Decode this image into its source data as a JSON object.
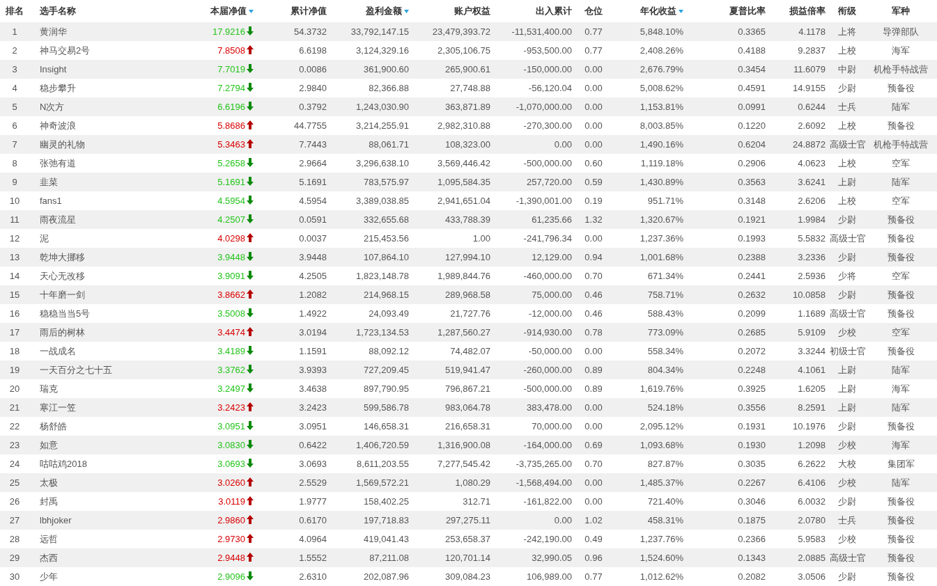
{
  "columns": [
    {
      "label": "排名",
      "sort_indicator": false
    },
    {
      "label": "选手名称",
      "sort_indicator": false
    },
    {
      "label": "本届净值",
      "sort_indicator": true
    },
    {
      "label": "累计净值",
      "sort_indicator": false
    },
    {
      "label": "盈利金额",
      "sort_indicator": true
    },
    {
      "label": "账户权益",
      "sort_indicator": false
    },
    {
      "label": "出入累计",
      "sort_indicator": false
    },
    {
      "label": "仓位",
      "sort_indicator": false
    },
    {
      "label": "年化收益",
      "sort_indicator": true
    },
    {
      "label": "夏普比率",
      "sort_indicator": false
    },
    {
      "label": "损益倍率",
      "sort_indicator": false
    },
    {
      "label": "衔级",
      "sort_indicator": false
    },
    {
      "label": "军种",
      "sort_indicator": false
    }
  ],
  "rows": [
    {
      "rank": "1",
      "name": "黄润华",
      "net_value": "17.9216",
      "rising": false,
      "cells": [
        "54.3732",
        "33,792,147.15",
        "23,479,393.72",
        "-11,531,400.00",
        "0.77",
        "5,848.10%",
        "0.3365",
        "4.1178",
        "上将",
        "导弹部队"
      ]
    },
    {
      "rank": "2",
      "name": "神马交易2号",
      "net_value": "7.8508",
      "rising": true,
      "cells": [
        "6.6198",
        "3,124,329.16",
        "2,305,106.75",
        "-953,500.00",
        "0.77",
        "2,408.26%",
        "0.4188",
        "9.2837",
        "上校",
        "海军"
      ]
    },
    {
      "rank": "3",
      "name": "Insight",
      "net_value": "7.7019",
      "rising": false,
      "cells": [
        "0.0086",
        "361,900.60",
        "265,900.61",
        "-150,000.00",
        "0.00",
        "2,676.79%",
        "0.3454",
        "11.6079",
        "中尉",
        "机枪手特战营"
      ]
    },
    {
      "rank": "4",
      "name": "稳步攀升",
      "net_value": "7.2794",
      "rising": false,
      "cells": [
        "2.9840",
        "82,366.88",
        "27,748.88",
        "-56,120.04",
        "0.00",
        "5,008.62%",
        "0.4591",
        "14.9155",
        "少尉",
        "预备役"
      ]
    },
    {
      "rank": "5",
      "name": "N次方",
      "net_value": "6.6196",
      "rising": false,
      "cells": [
        "0.3792",
        "1,243,030.90",
        "363,871.89",
        "-1,070,000.00",
        "0.00",
        "1,153.81%",
        "0.0991",
        "0.6244",
        "士兵",
        "陆军"
      ]
    },
    {
      "rank": "6",
      "name": "神奇波浪",
      "net_value": "5.8686",
      "rising": true,
      "cells": [
        "44.7755",
        "3,214,255.91",
        "2,982,310.88",
        "-270,300.00",
        "0.00",
        "8,003.85%",
        "0.1220",
        "2.6092",
        "上校",
        "预备役"
      ]
    },
    {
      "rank": "7",
      "name": "幽灵的礼物",
      "net_value": "5.3463",
      "rising": true,
      "cells": [
        "7.7443",
        "88,061.71",
        "108,323.00",
        "0.00",
        "0.00",
        "1,490.16%",
        "0.6204",
        "24.8872",
        "高级士官",
        "机枪手特战营"
      ]
    },
    {
      "rank": "8",
      "name": "张弛有道",
      "net_value": "5.2658",
      "rising": false,
      "cells": [
        "2.9664",
        "3,296,638.10",
        "3,569,446.42",
        "-500,000.00",
        "0.60",
        "1,119.18%",
        "0.2906",
        "4.0623",
        "上校",
        "空军"
      ]
    },
    {
      "rank": "9",
      "name": "韭菜",
      "net_value": "5.1691",
      "rising": false,
      "cells": [
        "5.1691",
        "783,575.97",
        "1,095,584.35",
        "257,720.00",
        "0.59",
        "1,430.89%",
        "0.3563",
        "3.6241",
        "上尉",
        "陆军"
      ]
    },
    {
      "rank": "10",
      "name": "fans1",
      "net_value": "4.5954",
      "rising": false,
      "cells": [
        "4.5954",
        "3,389,038.85",
        "2,941,651.04",
        "-1,390,001.00",
        "0.19",
        "951.71%",
        "0.3148",
        "2.6206",
        "上校",
        "空军"
      ]
    },
    {
      "rank": "11",
      "name": "雨夜流星",
      "net_value": "4.2507",
      "rising": false,
      "cells": [
        "0.0591",
        "332,655.68",
        "433,788.39",
        "61,235.66",
        "1.32",
        "1,320.67%",
        "0.1921",
        "1.9984",
        "少尉",
        "预备役"
      ]
    },
    {
      "rank": "12",
      "name": "泥",
      "net_value": "4.0298",
      "rising": true,
      "cells": [
        "0.0037",
        "215,453.56",
        "1.00",
        "-241,796.34",
        "0.00",
        "1,237.36%",
        "0.1993",
        "5.5832",
        "高级士官",
        "预备役"
      ]
    },
    {
      "rank": "13",
      "name": "乾坤大挪移",
      "net_value": "3.9448",
      "rising": false,
      "cells": [
        "3.9448",
        "107,864.10",
        "127,994.10",
        "12,129.00",
        "0.94",
        "1,001.68%",
        "0.2388",
        "3.2336",
        "少尉",
        "预备役"
      ]
    },
    {
      "rank": "14",
      "name": "天心无改移",
      "net_value": "3.9091",
      "rising": false,
      "cells": [
        "4.2505",
        "1,823,148.78",
        "1,989,844.76",
        "-460,000.00",
        "0.70",
        "671.34%",
        "0.2441",
        "2.5936",
        "少将",
        "空军"
      ]
    },
    {
      "rank": "15",
      "name": "十年磨一剑",
      "net_value": "3.8662",
      "rising": true,
      "cells": [
        "1.2082",
        "214,968.15",
        "289,968.58",
        "75,000.00",
        "0.46",
        "758.71%",
        "0.2632",
        "10.0858",
        "少尉",
        "预备役"
      ]
    },
    {
      "rank": "16",
      "name": "稳稳当当5号",
      "net_value": "3.5008",
      "rising": false,
      "cells": [
        "1.4922",
        "24,093.49",
        "21,727.76",
        "-12,000.00",
        "0.46",
        "588.43%",
        "0.2099",
        "1.1689",
        "高级士官",
        "预备役"
      ]
    },
    {
      "rank": "17",
      "name": "雨后的树林",
      "net_value": "3.4474",
      "rising": true,
      "cells": [
        "3.0194",
        "1,723,134.53",
        "1,287,560.27",
        "-914,930.00",
        "0.78",
        "773.09%",
        "0.2685",
        "5.9109",
        "少校",
        "空军"
      ]
    },
    {
      "rank": "18",
      "name": "一战成名",
      "net_value": "3.4189",
      "rising": false,
      "cells": [
        "1.1591",
        "88,092.12",
        "74,482.07",
        "-50,000.00",
        "0.00",
        "558.34%",
        "0.2072",
        "3.3244",
        "初级士官",
        "预备役"
      ]
    },
    {
      "rank": "19",
      "name": "一天百分之七十五",
      "net_value": "3.3762",
      "rising": false,
      "cells": [
        "3.9393",
        "727,209.45",
        "519,941.47",
        "-260,000.00",
        "0.89",
        "804.34%",
        "0.2248",
        "4.1061",
        "上尉",
        "陆军"
      ]
    },
    {
      "rank": "20",
      "name": "瑞克",
      "net_value": "3.2497",
      "rising": false,
      "cells": [
        "3.4638",
        "897,790.95",
        "796,867.21",
        "-500,000.00",
        "0.89",
        "1,619.76%",
        "0.3925",
        "1.6205",
        "上尉",
        "海军"
      ]
    },
    {
      "rank": "21",
      "name": "寒江一笠",
      "net_value": "3.2423",
      "rising": true,
      "cells": [
        "3.2423",
        "599,586.78",
        "983,064.78",
        "383,478.00",
        "0.00",
        "524.18%",
        "0.3556",
        "8.2591",
        "上尉",
        "陆军"
      ]
    },
    {
      "rank": "22",
      "name": "杨舒皓",
      "net_value": "3.0951",
      "rising": false,
      "cells": [
        "3.0951",
        "146,658.31",
        "216,658.31",
        "70,000.00",
        "0.00",
        "2,095.12%",
        "0.1931",
        "10.1976",
        "少尉",
        "预备役"
      ]
    },
    {
      "rank": "23",
      "name": "如意",
      "net_value": "3.0830",
      "rising": false,
      "cells": [
        "0.6422",
        "1,406,720.59",
        "1,316,900.08",
        "-164,000.00",
        "0.69",
        "1,093.68%",
        "0.1930",
        "1.2098",
        "少校",
        "海军"
      ]
    },
    {
      "rank": "24",
      "name": "咕咕鸡2018",
      "net_value": "3.0693",
      "rising": false,
      "cells": [
        "3.0693",
        "8,611,203.55",
        "7,277,545.42",
        "-3,735,265.00",
        "0.70",
        "827.87%",
        "0.3035",
        "6.2622",
        "大校",
        "集团军"
      ]
    },
    {
      "rank": "25",
      "name": "太极",
      "net_value": "3.0260",
      "rising": true,
      "cells": [
        "2.5529",
        "1,569,572.21",
        "1,080.29",
        "-1,568,494.00",
        "0.00",
        "1,485.37%",
        "0.2267",
        "6.4106",
        "少校",
        "陆军"
      ]
    },
    {
      "rank": "26",
      "name": "封禹",
      "net_value": "3.0119",
      "rising": true,
      "cells": [
        "1.9777",
        "158,402.25",
        "312.71",
        "-161,822.00",
        "0.00",
        "721.40%",
        "0.3046",
        "6.0032",
        "少尉",
        "预备役"
      ]
    },
    {
      "rank": "27",
      "name": "lbhjoker",
      "net_value": "2.9860",
      "rising": true,
      "cells": [
        "0.6170",
        "197,718.83",
        "297,275.11",
        "0.00",
        "1.02",
        "458.31%",
        "0.1875",
        "2.0780",
        "士兵",
        "预备役"
      ]
    },
    {
      "rank": "28",
      "name": "远哲",
      "net_value": "2.9730",
      "rising": true,
      "cells": [
        "4.0964",
        "419,041.43",
        "253,658.37",
        "-242,190.00",
        "0.49",
        "1,237.76%",
        "0.2366",
        "5.9583",
        "少校",
        "预备役"
      ]
    },
    {
      "rank": "29",
      "name": "杰西",
      "net_value": "2.9448",
      "rising": true,
      "cells": [
        "1.5552",
        "87,211.08",
        "120,701.14",
        "32,990.05",
        "0.96",
        "1,524.60%",
        "0.1343",
        "2.0885",
        "高级士官",
        "预备役"
      ]
    },
    {
      "rank": "30",
      "name": "少年",
      "net_value": "2.9096",
      "rising": false,
      "cells": [
        "2.6310",
        "202,087.96",
        "309,084.23",
        "106,989.00",
        "0.77",
        "1,012.62%",
        "0.2082",
        "3.0506",
        "少尉",
        "预备役"
      ]
    }
  ]
}
